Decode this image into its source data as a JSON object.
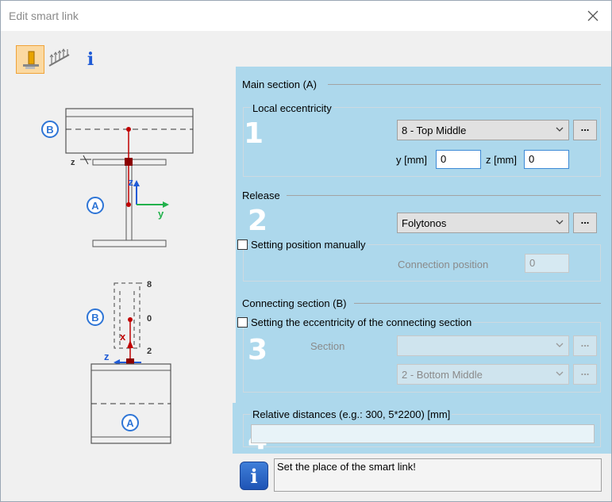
{
  "window": {
    "title": "Edit smart link"
  },
  "toolbar": {
    "info_glyph": "i"
  },
  "diagram": {
    "label_a": "A",
    "label_b": "B",
    "axis_z": "z",
    "axis_y": "y",
    "axis_x": "x",
    "tick_8": "8",
    "tick_0": "0",
    "tick_2": "2"
  },
  "main_section": {
    "header": "Main section (A)",
    "local_eccentricity_label": "Local eccentricity",
    "marker": "1",
    "position_value": "8 - Top Middle",
    "y_label": "y [mm]",
    "y_value": "0",
    "z_label": "z [mm]",
    "z_value": "0"
  },
  "release": {
    "header": "Release",
    "marker": "2",
    "value": "Folytonos",
    "manual_position_label": "Setting position manually",
    "connection_position_label": "Connection position",
    "connection_position_value": "0"
  },
  "connecting_section": {
    "header": "Connecting section (B)",
    "eccentricity_checkbox_label": "Setting the eccentricity of the connecting section",
    "marker": "3",
    "section_label": "Section",
    "section_value": "",
    "position_value": "2 - Bottom Middle"
  },
  "relative_distances": {
    "label": "Relative distances (e.g.: 300, 5*2200) [mm]",
    "marker": "4",
    "value": ""
  },
  "info": {
    "glyph": "i",
    "message": "Set the place of the smart link!"
  },
  "colors": {
    "highlight": "#add8ec",
    "member": "#c00000",
    "axis_blue": "#1f5bd6",
    "axis_green": "#22b14c"
  }
}
